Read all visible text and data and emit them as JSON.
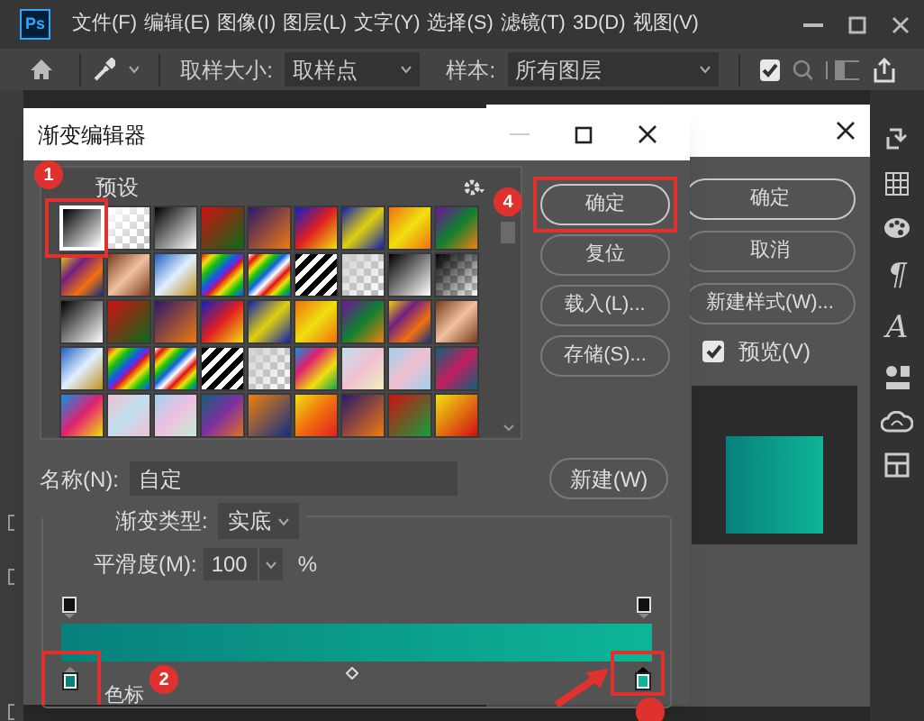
{
  "app_logo": "Ps",
  "menu": [
    "文件(F)",
    "编辑(E)",
    "图像(I)",
    "图层(L)",
    "文字(Y)",
    "选择(S)",
    "滤镜(T)",
    "3D(D)",
    "视图(V)"
  ],
  "options_bar": {
    "sample_size_label": "取样大小:",
    "sample_size": "取样点",
    "sample_label": "样本:",
    "sample": "所有图层",
    "ring_checked": true
  },
  "panel_icons": [
    {
      "kind": "rotate"
    },
    {
      "kind": "grid"
    },
    {
      "kind": "palette"
    },
    {
      "kind": "glyph",
      "text": "¶"
    },
    {
      "kind": "glyph",
      "text": "A"
    },
    {
      "kind": "library"
    },
    {
      "kind": "cloud"
    },
    {
      "kind": "layout"
    }
  ],
  "style_dialog": {
    "buttons": [
      {
        "label": "确定",
        "default": true
      },
      {
        "label": "取消",
        "default": false
      },
      {
        "label": "新建样式(W)...",
        "default": false
      }
    ],
    "preview": {
      "label": "预览(V)",
      "checked": true
    }
  },
  "gradient_editor": {
    "title": "渐变编辑器",
    "presets_label": "预设",
    "presets": [
      {
        "selected": true
      },
      {
        "selected": false
      },
      {
        "selected": false
      },
      {
        "selected": false
      },
      {
        "selected": false
      },
      {
        "selected": false
      },
      {
        "selected": false
      },
      {
        "selected": false
      },
      {
        "selected": false
      },
      {
        "selected": false
      },
      {
        "selected": false
      },
      {
        "selected": false
      },
      {
        "selected": false
      },
      {
        "selected": false
      },
      {
        "selected": false
      },
      {
        "selected": false
      },
      {
        "selected": false
      },
      {
        "selected": false
      },
      {
        "selected": false
      },
      {
        "selected": false
      },
      {
        "selected": false
      },
      {
        "selected": false
      },
      {
        "selected": false
      },
      {
        "selected": false
      },
      {
        "selected": false
      },
      {
        "selected": false
      },
      {
        "selected": false
      },
      {
        "selected": false
      },
      {
        "selected": false
      },
      {
        "selected": false
      },
      {
        "selected": false
      },
      {
        "selected": false
      },
      {
        "selected": false
      },
      {
        "selected": false
      },
      {
        "selected": false
      },
      {
        "selected": false
      },
      {
        "selected": false
      },
      {
        "selected": false
      },
      {
        "selected": false
      },
      {
        "selected": false
      },
      {
        "selected": false
      },
      {
        "selected": false
      },
      {
        "selected": false
      },
      {
        "selected": false
      },
      {
        "selected": false
      }
    ],
    "buttons": [
      {
        "label": "确定",
        "default": true
      },
      {
        "label": "复位",
        "default": false
      },
      {
        "label": "载入(L)...",
        "default": false
      },
      {
        "label": "存储(S)...",
        "default": false
      }
    ],
    "name_label": "名称(N):",
    "name_value": "自定",
    "new_button": "新建(W)",
    "type_label": "渐变类型:",
    "type_value": "实底",
    "smoothness_label": "平滑度(M):",
    "smoothness_value": "100",
    "smoothness_unit": "%",
    "opacity_stops": [
      {
        "selected": false
      },
      {
        "selected": false
      }
    ],
    "color_stops": [
      {
        "color": "#08807c",
        "selected": false
      },
      {
        "color": "#0db596",
        "selected": true
      }
    ],
    "stops_label": "色标"
  },
  "annotations": [
    {
      "label": "1"
    },
    {
      "label": "4"
    },
    {
      "label": "2"
    }
  ]
}
